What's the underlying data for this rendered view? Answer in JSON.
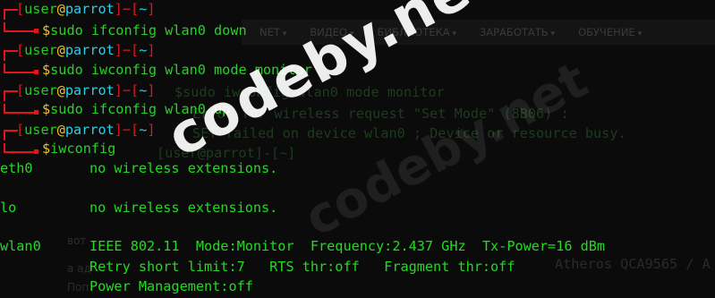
{
  "prompts": [
    {
      "user": "user",
      "at": "@",
      "host": "parrot",
      "cwd": "~",
      "command": "sudo ifconfig wlan0 down"
    },
    {
      "user": "user",
      "at": "@",
      "host": "parrot",
      "cwd": "~",
      "command": "sudo iwconfig wlan0 mode monitor"
    },
    {
      "user": "user",
      "at": "@",
      "host": "parrot",
      "cwd": "~",
      "command": "sudo ifconfig wlan0 up"
    },
    {
      "user": "user",
      "at": "@",
      "host": "parrot",
      "cwd": "~",
      "command": "iwconfig"
    }
  ],
  "output": {
    "eth0": {
      "iface": "eth0",
      "text": "no wireless extensions."
    },
    "lo": {
      "iface": "lo",
      "text": "no wireless extensions."
    },
    "wlan0": {
      "iface": "wlan0",
      "line1": "IEEE 802.11  Mode:Monitor  Frequency:2.437 GHz  Tx-Power=16 dBm",
      "line2": "Retry short limit:7   RTS thr:off   Fragment thr:off",
      "line3": "Power Management:off"
    }
  },
  "background": {
    "nav": [
      "NET",
      "ВИДЕО",
      "БИБЛИОТЕКА",
      "ЗАРАБОТАТЬ",
      "ОБУЧЕНИЕ"
    ],
    "ghost_lines": [
      "$sudo iwconfig wlan0 mode monitor",
      "Error for wireless request \"Set Mode\" (8B06) :",
      "SET failed on device wlan0 ; Device or resource busy.",
      "[user@parrot]-[~]"
    ],
    "ghost_text": [
      "вот",
      "а ад",
      "Поп",
      "Atheros QCA9565 / A"
    ]
  },
  "watermark": "codeby.net",
  "colors": {
    "background": "#0b0b0b",
    "bracket": "#e0161b",
    "user": "#1fd11f",
    "at": "#f2c21a",
    "host": "#2ad0e8",
    "command": "#2ad02a"
  }
}
